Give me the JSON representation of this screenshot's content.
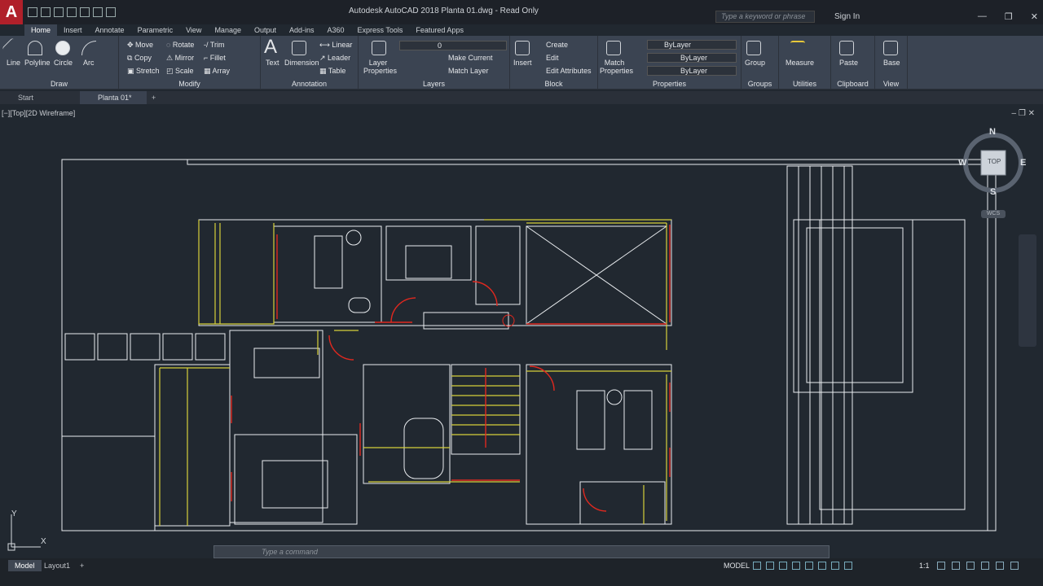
{
  "app": {
    "logo": "A",
    "title": "Autodesk AutoCAD 2018   Planta 01.dwg - Read Only",
    "search_placeholder": "Type a keyword or phrase",
    "sign_in": "Sign In"
  },
  "ribbon_tabs": [
    "Home",
    "Insert",
    "Annotate",
    "Parametric",
    "View",
    "Manage",
    "Output",
    "Add-ins",
    "A360",
    "Express Tools",
    "Featured Apps"
  ],
  "panels": {
    "draw": {
      "title": "Draw",
      "tools": [
        "Line",
        "Polyline",
        "Circle",
        "Arc"
      ]
    },
    "modify": {
      "title": "Modify",
      "tools": [
        "Move",
        "Rotate",
        "Trim",
        "Copy",
        "Mirror",
        "Fillet",
        "Stretch",
        "Scale",
        "Array"
      ]
    },
    "annotation": {
      "title": "Annotation",
      "tools": [
        "Text",
        "Dimension",
        "Linear",
        "Leader",
        "Table"
      ]
    },
    "layers": {
      "title": "Layers",
      "tools": [
        "Layer Properties",
        "Make Current",
        "Match Layer"
      ],
      "current": "0"
    },
    "block": {
      "title": "Block",
      "tools": [
        "Insert",
        "Create",
        "Edit",
        "Edit Attributes"
      ]
    },
    "properties": {
      "title": "Properties",
      "tools": [
        "Match Properties"
      ],
      "color": "ByLayer",
      "linetype": "ByLayer",
      "lineweight": "ByLayer"
    },
    "groups": {
      "title": "Groups",
      "tools": [
        "Group"
      ]
    },
    "utilities": {
      "title": "Utilities",
      "tools": [
        "Measure"
      ]
    },
    "clipboard": {
      "title": "Clipboard",
      "tools": [
        "Paste"
      ]
    },
    "view": {
      "title": "View",
      "tools": [
        "Base"
      ]
    }
  },
  "doc_tabs": [
    "Start",
    "Planta 01*"
  ],
  "viewport": {
    "label": "[−][Top][2D Wireframe]",
    "viewcube": {
      "n": "N",
      "s": "S",
      "e": "E",
      "w": "W",
      "face": "TOP",
      "ucs": "WCS"
    },
    "axis_x": "X",
    "axis_y": "Y"
  },
  "command": {
    "placeholder": "Type a command"
  },
  "layouts": [
    "Model",
    "Layout1"
  ],
  "status": {
    "mode": "MODEL",
    "scale": "1:1"
  },
  "colors": {
    "wall": "#e9ecef",
    "yellow": "#d6d03a",
    "red": "#e0281f",
    "bg": "#212830"
  }
}
